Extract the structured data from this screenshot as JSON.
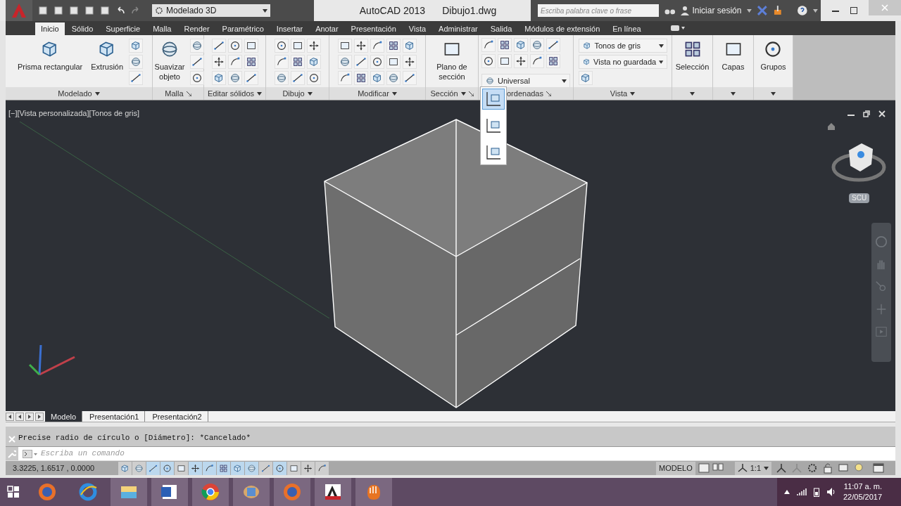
{
  "window": {
    "title": "AutoCAD 2013",
    "document": "Dibujo1.dwg"
  },
  "workspace": "Modelado 3D",
  "search": {
    "placeholder": "Escriba palabra clave o frase"
  },
  "sign_in": "Iniciar sesión",
  "tabs": [
    {
      "label": "Inicio",
      "selected": true
    },
    {
      "label": "Sólido",
      "selected": false
    },
    {
      "label": "Superficie",
      "selected": false
    },
    {
      "label": "Malla",
      "selected": false
    },
    {
      "label": "Render",
      "selected": false
    },
    {
      "label": "Paramétrico",
      "selected": false
    },
    {
      "label": "Insertar",
      "selected": false
    },
    {
      "label": "Anotar",
      "selected": false
    },
    {
      "label": "Presentación",
      "selected": false
    },
    {
      "label": "Vista",
      "selected": false
    },
    {
      "label": "Administrar",
      "selected": false
    },
    {
      "label": "Salida",
      "selected": false
    },
    {
      "label": "Módulos de extensión",
      "selected": false
    },
    {
      "label": "En línea",
      "selected": false
    }
  ],
  "ribbon_panels": [
    {
      "title": "Modelado",
      "large": [
        "Prisma rectangular",
        "Extrusión"
      ],
      "menu": true,
      "launcher": false
    },
    {
      "title": "Malla",
      "large": [
        "Suavizar objeto"
      ],
      "menu": false,
      "launcher": true
    },
    {
      "title": "Editar sólidos",
      "menu": true,
      "launcher": false
    },
    {
      "title": "Dibujo",
      "menu": true,
      "launcher": false
    },
    {
      "title": "Modificar",
      "menu": true,
      "launcher": false
    },
    {
      "title": "Sección",
      "large": [
        "Plano de sección"
      ],
      "menu": true,
      "launcher": true
    },
    {
      "title": "ordenadas",
      "dropdowns": [
        "Universal"
      ],
      "menu": false,
      "launcher": true
    },
    {
      "title": "Vista",
      "dropdowns": [
        "Tonos de gris",
        "Vista no guardada"
      ],
      "menu": true,
      "launcher": false
    },
    {
      "large": [
        "Selección"
      ],
      "menu": true,
      "launcher": false
    },
    {
      "large": [
        "Capas"
      ],
      "menu": true,
      "launcher": false
    },
    {
      "large": [
        "Grupos"
      ],
      "menu": true,
      "launcher": false
    }
  ],
  "ucs_menu": [
    {
      "selected": true
    },
    {
      "selected": false
    },
    {
      "selected": false
    }
  ],
  "viewport": {
    "label": "[−][Vista personalizada][Tonos de gris]",
    "ucs": "SCU"
  },
  "layout_tabs": [
    {
      "label": "Modelo",
      "selected": true
    },
    {
      "label": "Presentación1",
      "selected": false
    },
    {
      "label": "Presentación2",
      "selected": false
    }
  ],
  "command": {
    "history": "Precise radio de círculo o [Diámetro]: *Cancelado*",
    "placeholder": "Escriba un comando"
  },
  "status": {
    "coordinates": "3.3225, 1.6517 , 0.0000",
    "space": "MODELO",
    "scale": "1:1",
    "toggles": [
      {
        "on": false
      },
      {
        "on": false
      },
      {
        "on": true
      },
      {
        "on": true
      },
      {
        "on": false
      },
      {
        "on": true
      },
      {
        "on": true
      },
      {
        "on": true
      },
      {
        "on": true
      },
      {
        "on": true
      },
      {
        "on": false
      },
      {
        "on": true
      },
      {
        "on": false
      },
      {
        "on": false
      },
      {
        "on": false
      }
    ]
  },
  "taskbar": {
    "apps": [
      {
        "running": false
      },
      {
        "running": false
      },
      {
        "running": true
      },
      {
        "running": true
      },
      {
        "running": true
      },
      {
        "running": true
      },
      {
        "running": true
      },
      {
        "running": true
      },
      {
        "running": true
      }
    ],
    "time": "11:07 a. m.",
    "date": "22/05/2017"
  }
}
